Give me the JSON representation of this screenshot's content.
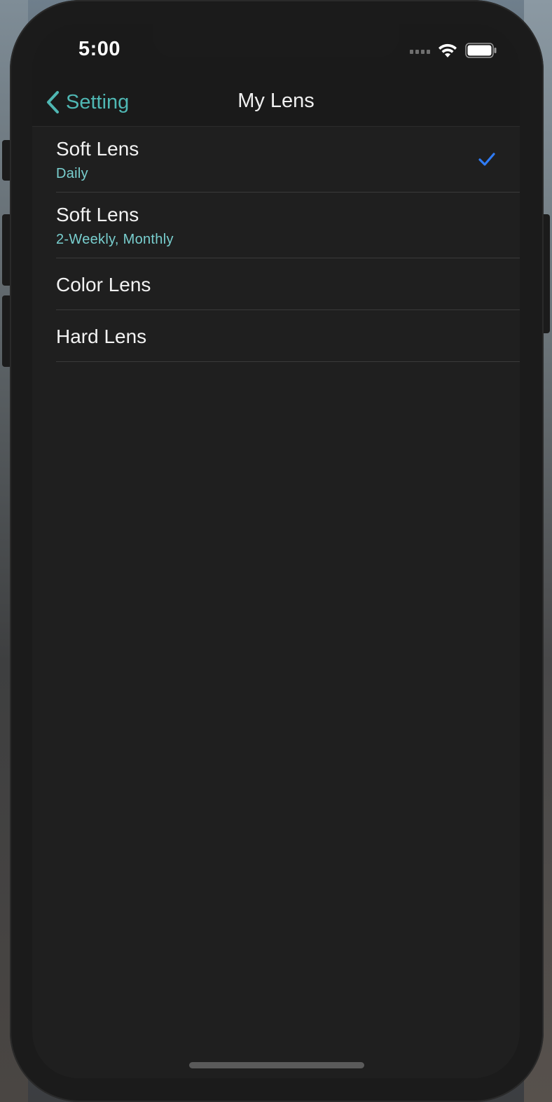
{
  "status_bar": {
    "time": "5:00",
    "icons": [
      "cellular-signal-icon",
      "wifi-icon",
      "battery-icon"
    ]
  },
  "nav": {
    "back_label": "Setting",
    "title": "My Lens"
  },
  "lens_list": [
    {
      "title": "Soft Lens",
      "subtitle": "Daily",
      "selected": true
    },
    {
      "title": "Soft Lens",
      "subtitle": "2-Weekly, Monthly",
      "selected": false
    },
    {
      "title": "Color Lens",
      "subtitle": "",
      "selected": false
    },
    {
      "title": "Hard Lens",
      "subtitle": "",
      "selected": false
    }
  ],
  "colors": {
    "accent": "#4fb7b3",
    "subtitle": "#79cfcf",
    "checkmark": "#2f7bf5",
    "background": "#1f1f1f"
  }
}
